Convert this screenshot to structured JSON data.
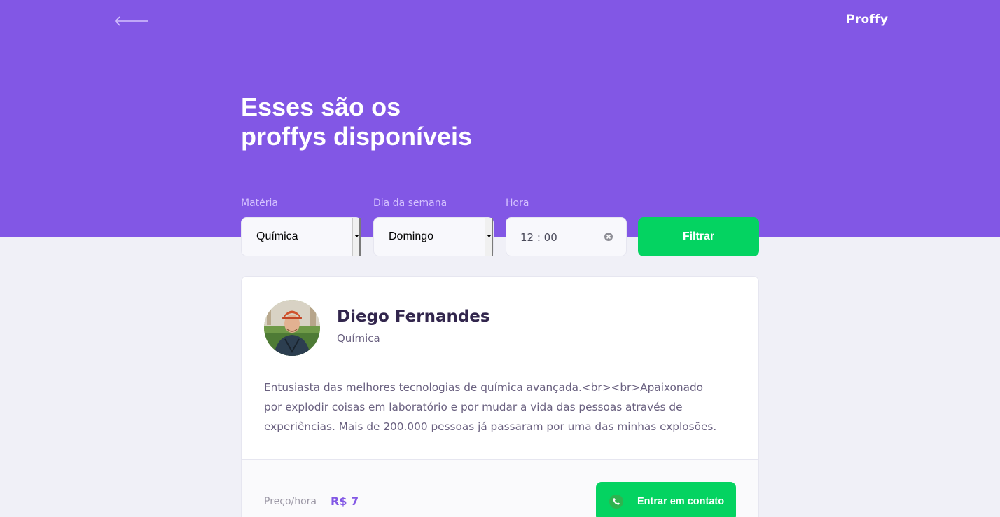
{
  "header": {
    "logo": "Proffy",
    "back_icon": "arrow-left-icon"
  },
  "page": {
    "title_line1": "Esses são os",
    "title_line2": "proffys disponíveis"
  },
  "filters": {
    "subject": {
      "label": "Matéria",
      "value": "Química"
    },
    "weekday": {
      "label": "Dia da semana",
      "value": "Domingo"
    },
    "time": {
      "label": "Hora",
      "value": "12 : 00"
    },
    "submit_label": "Filtrar"
  },
  "teacher": {
    "name": "Diego Fernandes",
    "subject": "Química",
    "bio_line1": "Entusiasta das melhores tecnologias de química avançada.<br><br>Apaixonado",
    "bio_line2": "por explodir coisas em laboratório e por mudar a vida das pessoas através de",
    "bio_line3": "experiências. Mais de 200.000 pessoas já passaram por uma das minhas explosões.",
    "price_label": "Preço/hora",
    "price_value": "R$ 7",
    "contact_label": "Entrar em contato",
    "contact_icon": "whatsapp-icon"
  },
  "colors": {
    "primary": "#8257E5",
    "secondary": "#04D361",
    "background": "#F0F0F7",
    "title_text": "#32264D",
    "body_text": "#6A6180"
  }
}
